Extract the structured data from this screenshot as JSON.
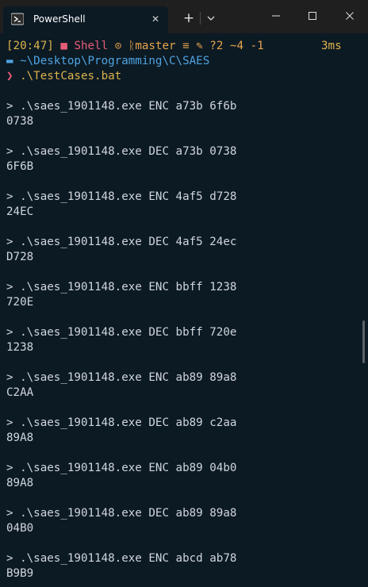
{
  "window": {
    "tab_title": "PowerShell",
    "new_tab_label": "+",
    "tab_close_label": "✕",
    "minimize_icon": "minimize-icon",
    "maximize_icon": "maximize-icon",
    "close_icon": "close-icon"
  },
  "prompt": {
    "time": "[20:47]",
    "shell_label": "Shell",
    "branch": "master",
    "git_status": "≡ ✎ ?2 ~4 -1",
    "duration": "3ms",
    "path": "~\\Desktop\\Programming\\C\\SAES",
    "chevron": "❯",
    "command": ".\\TestCases.bat"
  },
  "output": [
    {
      "cmd": "> .\\saes_1901148.exe ENC a73b 6f6b",
      "result": "0738"
    },
    {
      "cmd": "> .\\saes_1901148.exe DEC a73b 0738",
      "result": "6F6B"
    },
    {
      "cmd": "> .\\saes_1901148.exe ENC 4af5 d728",
      "result": "24EC"
    },
    {
      "cmd": "> .\\saes_1901148.exe DEC 4af5 24ec",
      "result": "D728"
    },
    {
      "cmd": "> .\\saes_1901148.exe ENC bbff 1238",
      "result": "720E"
    },
    {
      "cmd": "> .\\saes_1901148.exe DEC bbff 720e",
      "result": "1238"
    },
    {
      "cmd": "> .\\saes_1901148.exe ENC ab89 89a8",
      "result": "C2AA"
    },
    {
      "cmd": "> .\\saes_1901148.exe DEC ab89 c2aa",
      "result": "89A8"
    },
    {
      "cmd": "> .\\saes_1901148.exe ENC ab89 04b0",
      "result": "89A8"
    },
    {
      "cmd": "> .\\saes_1901148.exe DEC ab89 89a8",
      "result": "04B0"
    },
    {
      "cmd": "> .\\saes_1901148.exe ENC abcd ab78",
      "result": "B9B9"
    }
  ],
  "colors": {
    "background": "#0c1a24",
    "text": "#d0d6dc",
    "accent_yellow": "#dcb34b",
    "accent_pink": "#e85d78",
    "path_blue": "#4fa3e0"
  }
}
